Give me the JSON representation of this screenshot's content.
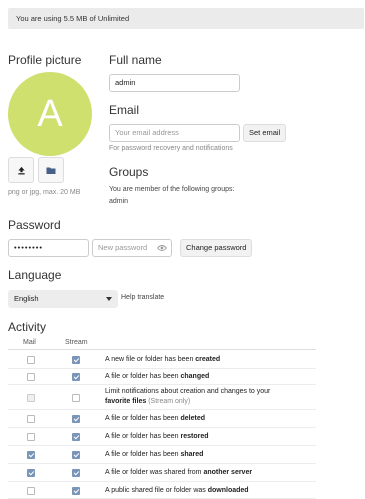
{
  "quota_text": "You are using 5.5 MB of Unlimited",
  "profile": {
    "picture_heading": "Profile picture",
    "avatar_letter": "A",
    "avatar_color": "#cfe06f",
    "upload_icon": "upload-icon",
    "folder_icon": "folder-icon",
    "hint": "png or jpg, max. 20 MB"
  },
  "fullname": {
    "heading": "Full name",
    "value": "admin"
  },
  "email": {
    "heading": "Email",
    "placeholder": "Your email address",
    "button": "Set email",
    "hint": "For password recovery and notifications"
  },
  "groups": {
    "heading": "Groups",
    "text": "You are member of the following groups:",
    "list": "admin"
  },
  "password": {
    "heading": "Password",
    "current_value": "••••••••",
    "new_placeholder": "New password",
    "eye_icon": "eye-icon",
    "button": "Change password"
  },
  "language": {
    "heading": "Language",
    "selected": "English",
    "help_link": "Help translate"
  },
  "activity": {
    "heading": "Activity",
    "col_mail": "Mail",
    "col_stream": "Stream",
    "rows": [
      {
        "pre": "A new file or folder has been ",
        "bold": "created",
        "post": "",
        "mail": false,
        "stream": true
      },
      {
        "pre": "A file or folder has been ",
        "bold": "changed",
        "post": "",
        "mail": false,
        "stream": true
      },
      {
        "line1": "Limit notifications about creation and changes to your",
        "bold": "favorite files",
        "post": " (Stream only)",
        "mail": false,
        "stream": false,
        "mail_disabled": true
      },
      {
        "pre": "A file or folder has been ",
        "bold": "deleted",
        "post": "",
        "mail": false,
        "stream": true
      },
      {
        "pre": "A file or folder has been ",
        "bold": "restored",
        "post": "",
        "mail": false,
        "stream": true
      },
      {
        "pre": "A file or folder has been ",
        "bold": "shared",
        "post": "",
        "mail": true,
        "stream": true
      },
      {
        "pre": "A file or folder was shared from ",
        "bold": "another server",
        "post": "",
        "mail": true,
        "stream": true
      },
      {
        "pre": "A public shared file or folder was ",
        "bold": "downloaded",
        "post": "",
        "mail": false,
        "stream": true
      }
    ]
  }
}
